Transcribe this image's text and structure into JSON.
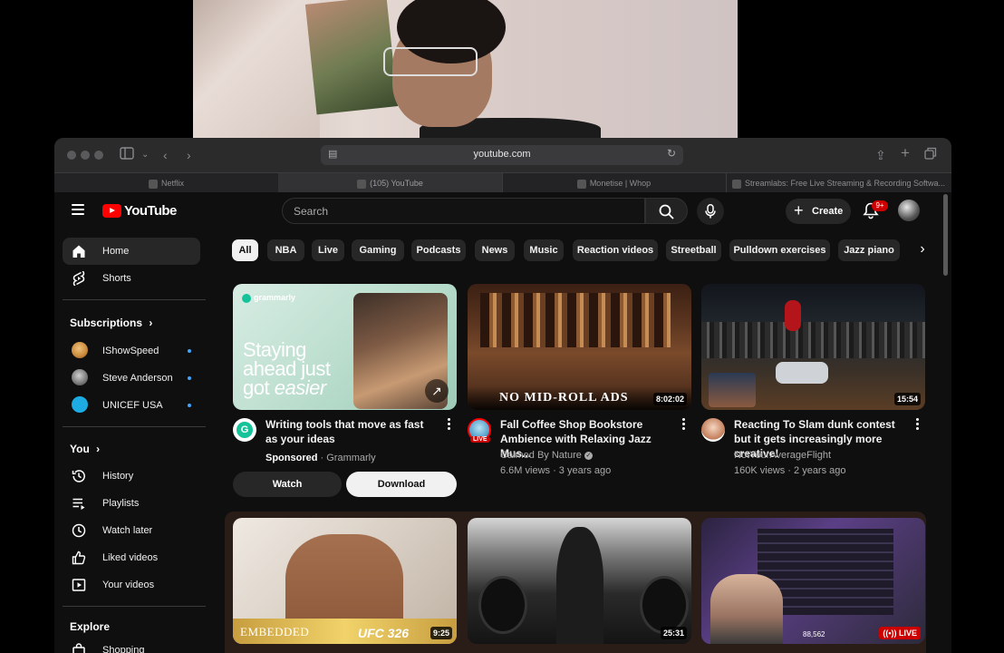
{
  "browser": {
    "url": "youtube.com",
    "tabs": [
      {
        "label": "Netflix",
        "active": false
      },
      {
        "label": "(105) YouTube",
        "active": true
      },
      {
        "label": "Monetise | Whop",
        "active": false
      },
      {
        "label": "Streamlabs: Free Live Streaming & Recording Softwa...",
        "active": false
      }
    ]
  },
  "header": {
    "logo": "YouTube",
    "search_placeholder": "Search",
    "create_label": "Create",
    "notification_badge": "9+"
  },
  "sidebar": {
    "main": [
      {
        "label": "Home",
        "icon": "home-icon",
        "active": true
      },
      {
        "label": "Shorts",
        "icon": "shorts-icon",
        "active": false
      }
    ],
    "subscriptions_heading": "Subscriptions",
    "subscriptions": [
      {
        "label": "IShowSpeed",
        "color": "#c98a3a"
      },
      {
        "label": "Steve Anderson",
        "color": "#8a8a8a"
      },
      {
        "label": "UNICEF USA",
        "color": "#1cabe2"
      }
    ],
    "you_heading": "You",
    "you": [
      {
        "label": "History",
        "icon": "history-icon"
      },
      {
        "label": "Playlists",
        "icon": "playlists-icon"
      },
      {
        "label": "Watch later",
        "icon": "watch-later-icon"
      },
      {
        "label": "Liked videos",
        "icon": "liked-videos-icon"
      },
      {
        "label": "Your videos",
        "icon": "your-videos-icon"
      }
    ],
    "explore_heading": "Explore",
    "explore": [
      {
        "label": "Shopping",
        "icon": "shopping-icon"
      }
    ]
  },
  "chips": [
    "All",
    "NBA",
    "Live",
    "Gaming",
    "Podcasts",
    "News",
    "Music",
    "Reaction videos",
    "Streetball",
    "Pulldown exercises",
    "Jazz piano"
  ],
  "ad": {
    "brand_mark": "grammarly",
    "headline_1": "Staying",
    "headline_2": "ahead just",
    "headline_3": "got",
    "headline_4": "easier",
    "title": "Writing tools that move as fast as your ideas",
    "sponsored": "Sponsored",
    "advertiser": " · Grammarly",
    "watch_label": "Watch",
    "download_label": "Download"
  },
  "videos": [
    {
      "title": "Fall Coffee Shop Bookstore Ambience with Relaxing Jazz Mus...",
      "channel": "Calmed By Nature",
      "stats": "6.6M views · 3 years ago",
      "duration": "8:02:02",
      "overlay": "NO MID-ROLL ADS",
      "avatar_badge": "LIVE"
    },
    {
      "title": "Reacting To Slam dunk contest but it gets increasingly more creative!",
      "channel": "NotYourAverageFlight",
      "stats": "160K views · 2 years ago",
      "duration": "15:54"
    },
    {
      "duration": "9:25",
      "overlay_left": "EMBEDDED",
      "overlay_right": "UFC 326"
    },
    {
      "duration": "25:31"
    },
    {
      "live_label": "LIVE",
      "viewer_text": "88,562"
    }
  ]
}
